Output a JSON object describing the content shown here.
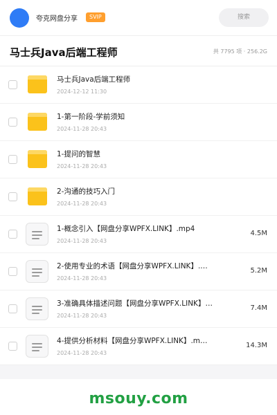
{
  "header": {
    "username": "夸克网盘分享",
    "badge": "SVIP",
    "search_placeholder": "搜索"
  },
  "folder": {
    "title": "马士兵Java后端工程师",
    "summary": "共 7795 项 · 256.2G"
  },
  "items": [
    {
      "type": "folder",
      "name": "马士兵Java后端工程师",
      "date": "2024-12-12 11:30",
      "size": ""
    },
    {
      "type": "folder",
      "name": "1-第一阶段-学前须知",
      "date": "2024-11-28 20:43",
      "size": ""
    },
    {
      "type": "folder",
      "name": "1-提问的智慧",
      "date": "2024-11-28 20:43",
      "size": ""
    },
    {
      "type": "folder",
      "name": "2-沟通的技巧入门",
      "date": "2024-11-28 20:43",
      "size": ""
    },
    {
      "type": "file",
      "name": "1-概念引入【网盘分享WPFX.LINK】.mp4",
      "date": "2024-11-28 20:43",
      "size": "4.5M"
    },
    {
      "type": "file",
      "name": "2-使用专业的术语【网盘分享WPFX.LINK】.…",
      "date": "2024-11-28 20:43",
      "size": "5.2M"
    },
    {
      "type": "file",
      "name": "3-准确具体描述问题【网盘分享WPFX.LINK】…",
      "date": "2024-11-28 20:43",
      "size": "7.4M"
    },
    {
      "type": "file",
      "name": "4-提供分析材料【网盘分享WPFX.LINK】.m…",
      "date": "2024-11-28 20:43",
      "size": "14.3M"
    }
  ],
  "footer": {
    "watermark": "msouy.com"
  },
  "colors": {
    "accent": "#2f7cf6",
    "badge": "#ff9f2e",
    "folder": "#fbc21b",
    "watermark": "#22a043"
  }
}
